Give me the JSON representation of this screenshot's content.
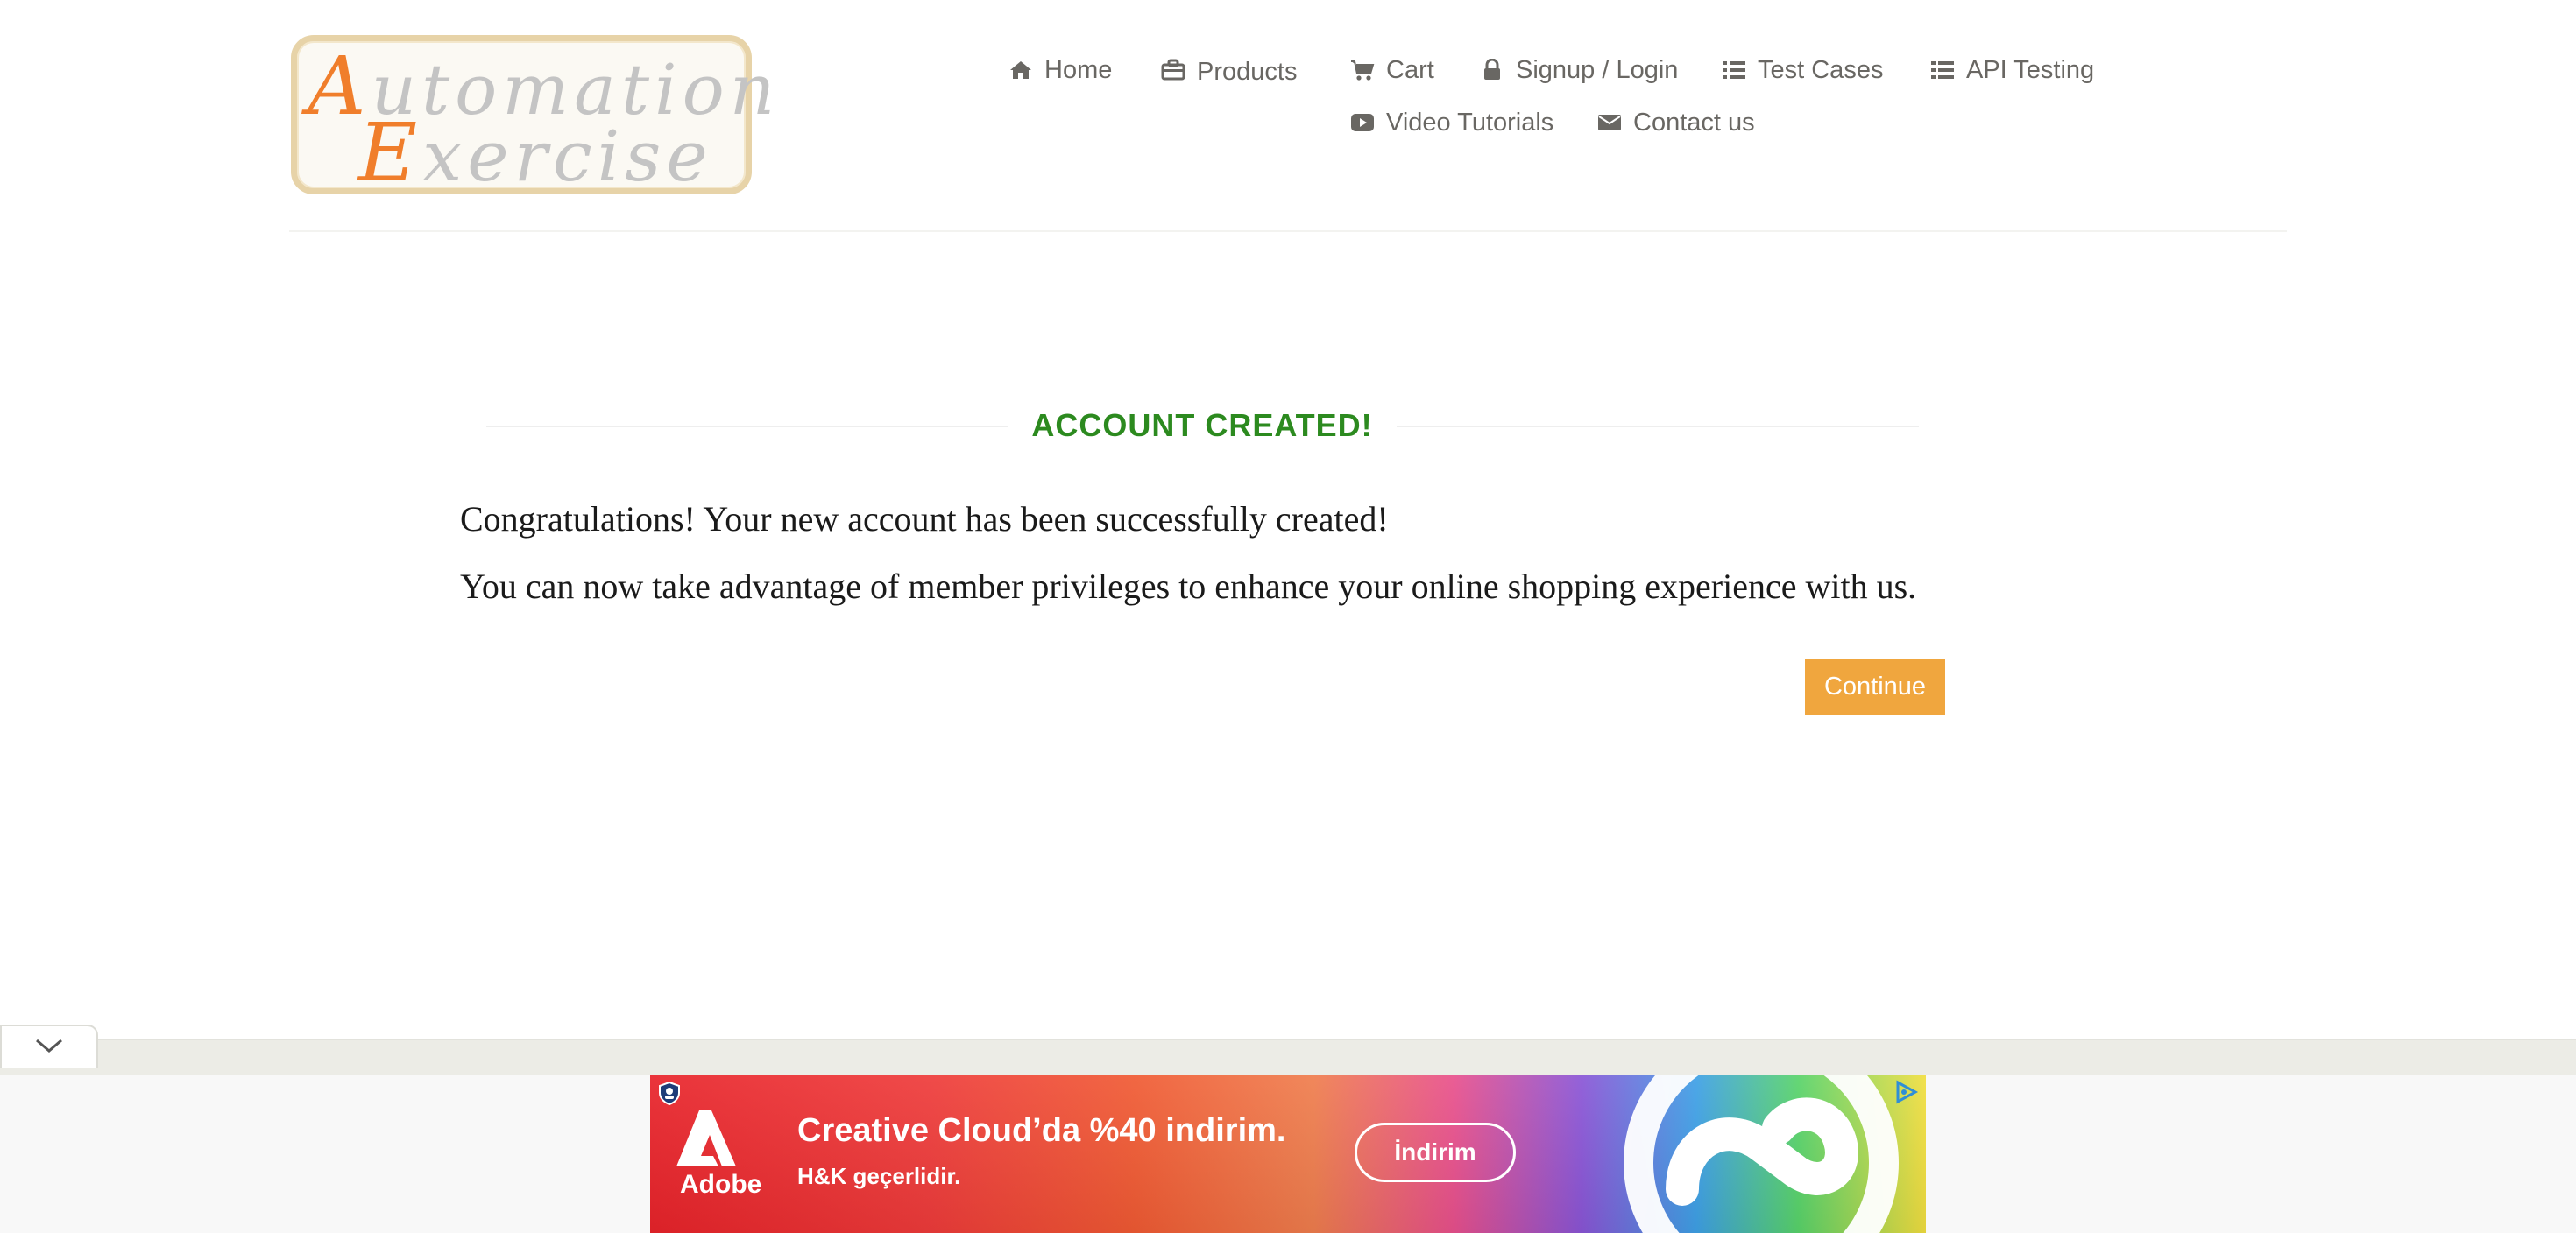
{
  "brand": {
    "logo_line1": "Automation",
    "logo_line2": "Exercise",
    "logo_colors": {
      "accent": "#f07e2b",
      "text": "#c4c4c4",
      "frame": "#e7d3a8"
    }
  },
  "nav": {
    "items": [
      {
        "label": "Home",
        "icon": "home-icon"
      },
      {
        "label": "Products",
        "icon": "briefcase-icon"
      },
      {
        "label": "Cart",
        "icon": "cart-icon"
      },
      {
        "label": "Signup / Login",
        "icon": "lock-icon"
      },
      {
        "label": "Test Cases",
        "icon": "list-icon"
      },
      {
        "label": "API Testing",
        "icon": "list-icon"
      },
      {
        "label": "Video Tutorials",
        "icon": "youtube-play-icon"
      },
      {
        "label": "Contact us",
        "icon": "envelope-icon"
      }
    ]
  },
  "main": {
    "title": "ACCOUNT CREATED!",
    "message_1": "Congratulations! Your new account has been successfully created!",
    "message_2": "You can now take advantage of member privileges to enhance your online shopping experience with us.",
    "continue_label": "Continue"
  },
  "ad": {
    "brand_name": "Adobe",
    "headline": "Creative Cloud’da %40 indirim.",
    "subtext": "H&K geçerlidir.",
    "cta_label": "İndirim",
    "toggle_icon": "chevron-down-icon",
    "choices_icon": "adchoices-icon"
  },
  "colors": {
    "title_green": "#2c8a1f",
    "button_orange": "#f0a63e",
    "nav_text": "#696763"
  }
}
